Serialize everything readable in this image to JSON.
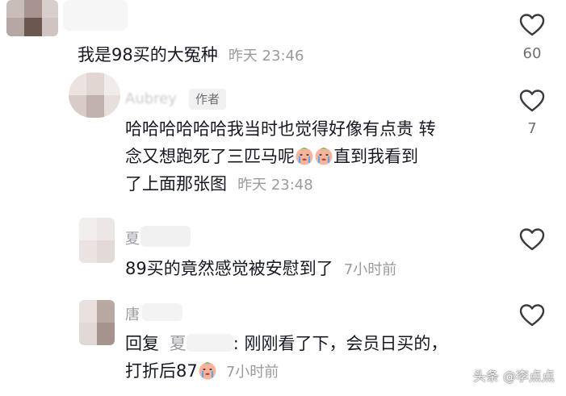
{
  "comments": [
    {
      "text": "我是98买的大冤种",
      "time": "昨天 23:46",
      "like_count": "60"
    },
    {
      "author": "Aubrey",
      "author_tag": "作者",
      "line1": "哈哈哈哈哈哈我当时也觉得好像有点贵 转",
      "line2_a": "念又想跑死了三匹马呢",
      "line2_b": "直到我看到",
      "line3": "了上面那张图",
      "time": "昨天 23:48",
      "like_count": "7",
      "emojis": [
        "crying-face-emoji",
        "crying-face-emoji"
      ]
    },
    {
      "author": "夏",
      "text": "89买的竟然感觉被安慰到了",
      "time": "7小时前"
    },
    {
      "author": "唐",
      "reply_prefix": "回复",
      "reply_to": "夏",
      "line1_rest": ": 刚刚看了下，会员日买的，",
      "line2": "打折后87",
      "time": "7小时前",
      "emojis": [
        "crying-face-emoji"
      ]
    }
  ],
  "watermark": "头条 @李点点",
  "colors": {
    "text": "#161823",
    "meta": "#9a9ba0",
    "icon": "#3a3b40"
  }
}
